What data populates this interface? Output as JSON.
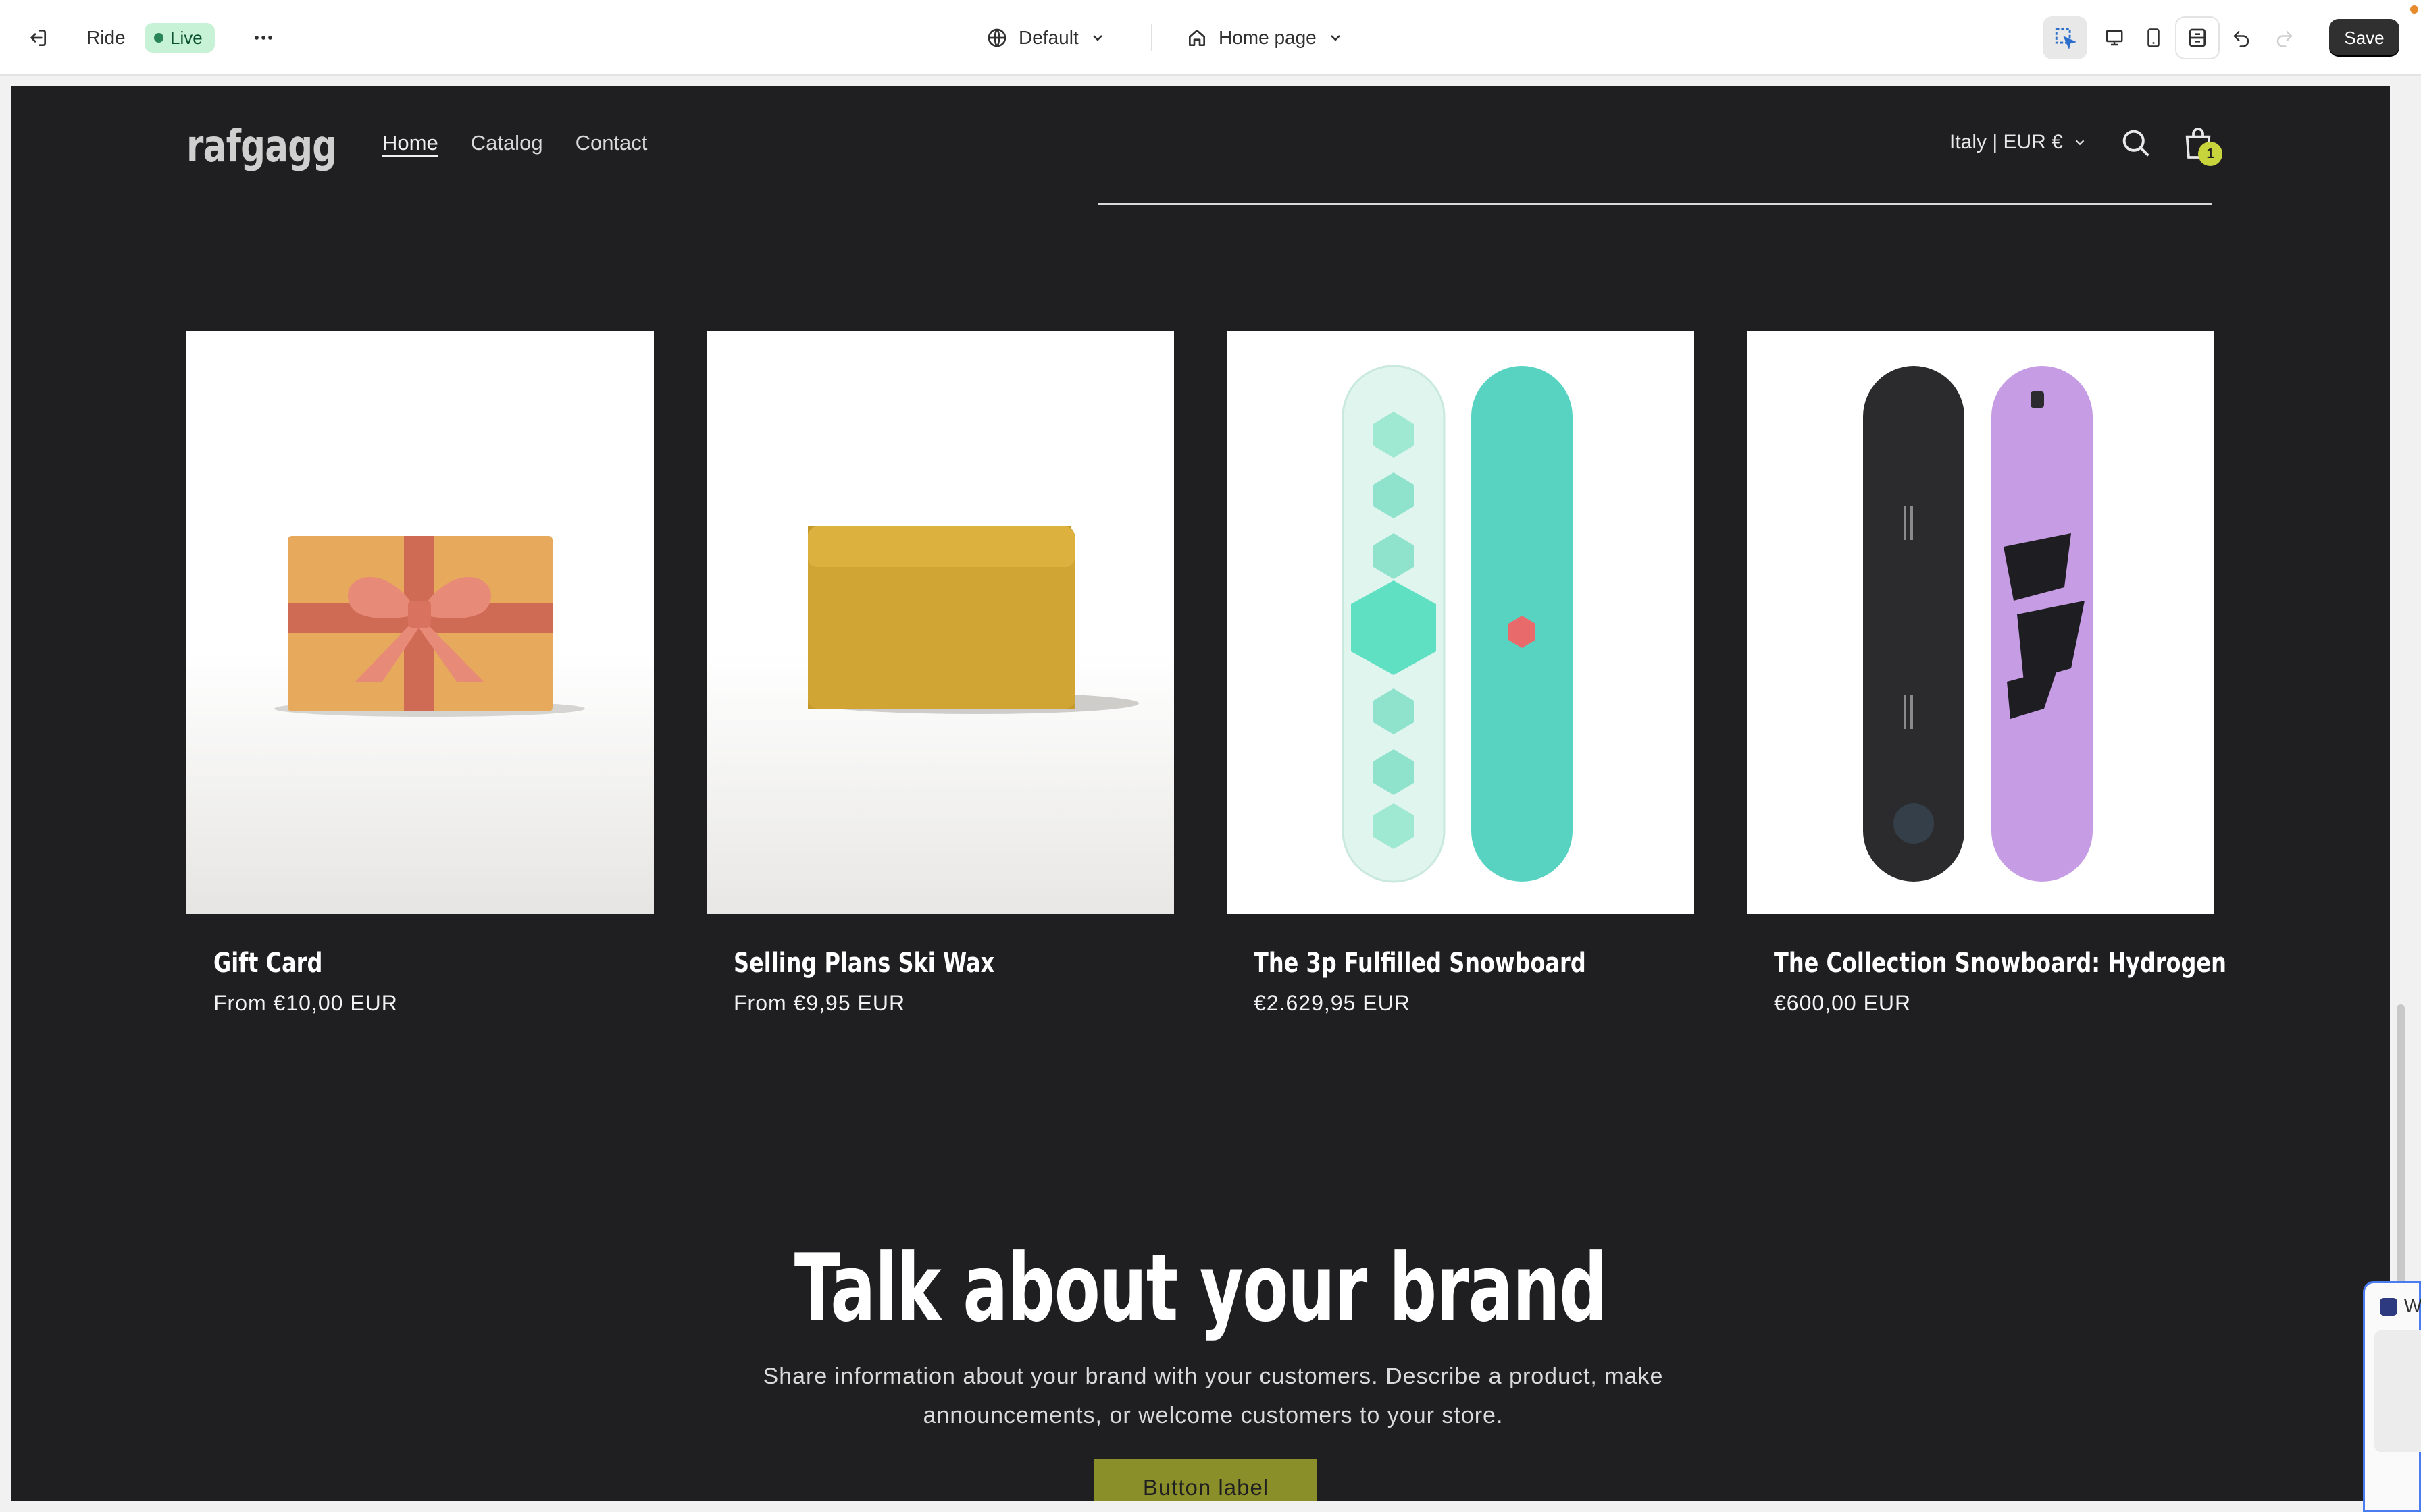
{
  "editor": {
    "store_name": "Ride",
    "status": "Live",
    "theme": "Default",
    "page": "Home page",
    "save_label": "Save"
  },
  "store": {
    "logo": "rafgagg",
    "nav": [
      "Home",
      "Catalog",
      "Contact"
    ],
    "country": "Italy | EUR €",
    "cart_count": "1"
  },
  "products": [
    {
      "title": "Gift Card",
      "price": "From €10,00 EUR"
    },
    {
      "title": "Selling Plans Ski Wax",
      "price": "From €9,95 EUR"
    },
    {
      "title": "The 3p Fulfilled Snowboard",
      "price": "€2.629,95 EUR"
    },
    {
      "title": "The Collection Snowboard: Hydrogen",
      "price": "€600,00 EUR"
    }
  ],
  "brand": {
    "heading": "Talk about your brand",
    "text_line1": "Share information about your brand with your customers. Describe a product, make",
    "text_line2": "announcements, or welcome customers to your store.",
    "button": "Button label"
  },
  "floating_panel": {
    "label": "W"
  },
  "colors": {
    "canvas_bg": "#1f1f21",
    "live_badge_bg": "#c8f2d6",
    "save_bg": "#303030",
    "brand_button": "#8a8f2a",
    "cart_badge": "#c8d43c"
  }
}
